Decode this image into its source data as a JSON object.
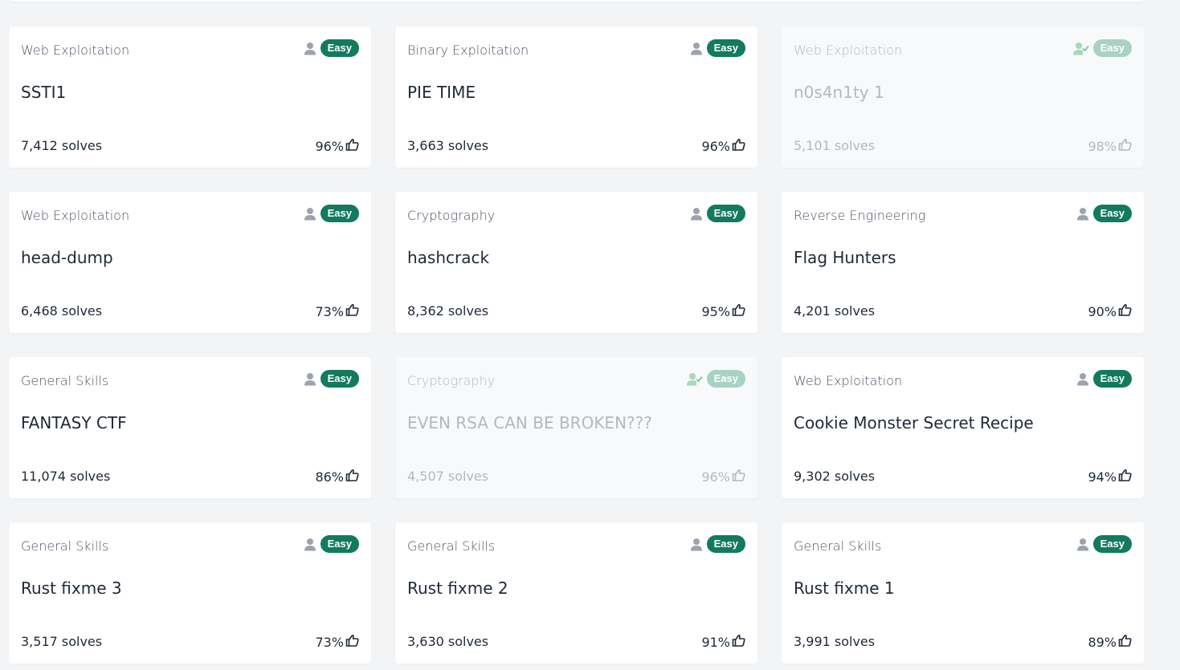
{
  "badge_label": "Easy",
  "colors": {
    "badge": "#137a5f",
    "badge_solved": "#a8d2c4",
    "solved_check": "#7cc59a",
    "background": "#f3f4f6"
  },
  "icons": {
    "user": "user-icon",
    "user_solved": "user-check-icon",
    "thumbs_up": "thumbs-up-icon"
  },
  "cards": [
    {
      "category": "Web Exploitation",
      "title": "SSTI1",
      "solves": "7,412 solves",
      "rating": "96%",
      "solved": false
    },
    {
      "category": "Binary Exploitation",
      "title": "PIE TIME",
      "solves": "3,663 solves",
      "rating": "96%",
      "solved": false
    },
    {
      "category": "Web Exploitation",
      "title": "n0s4n1ty 1",
      "solves": "5,101 solves",
      "rating": "98%",
      "solved": true
    },
    {
      "category": "Web Exploitation",
      "title": "head-dump",
      "solves": "6,468 solves",
      "rating": "73%",
      "solved": false
    },
    {
      "category": "Cryptography",
      "title": "hashcrack",
      "solves": "8,362 solves",
      "rating": "95%",
      "solved": false
    },
    {
      "category": "Reverse Engineering",
      "title": "Flag Hunters",
      "solves": "4,201 solves",
      "rating": "90%",
      "solved": false
    },
    {
      "category": "General Skills",
      "title": "FANTASY CTF",
      "solves": "11,074 solves",
      "rating": "86%",
      "solved": false
    },
    {
      "category": "Cryptography",
      "title": "EVEN RSA CAN BE BROKEN???",
      "solves": "4,507 solves",
      "rating": "96%",
      "solved": true
    },
    {
      "category": "Web Exploitation",
      "title": "Cookie Monster Secret Recipe",
      "solves": "9,302 solves",
      "rating": "94%",
      "solved": false
    },
    {
      "category": "General Skills",
      "title": "Rust fixme 3",
      "solves": "3,517 solves",
      "rating": "73%",
      "solved": false
    },
    {
      "category": "General Skills",
      "title": "Rust fixme 2",
      "solves": "3,630 solves",
      "rating": "91%",
      "solved": false
    },
    {
      "category": "General Skills",
      "title": "Rust fixme 1",
      "solves": "3,991 solves",
      "rating": "89%",
      "solved": false
    }
  ]
}
